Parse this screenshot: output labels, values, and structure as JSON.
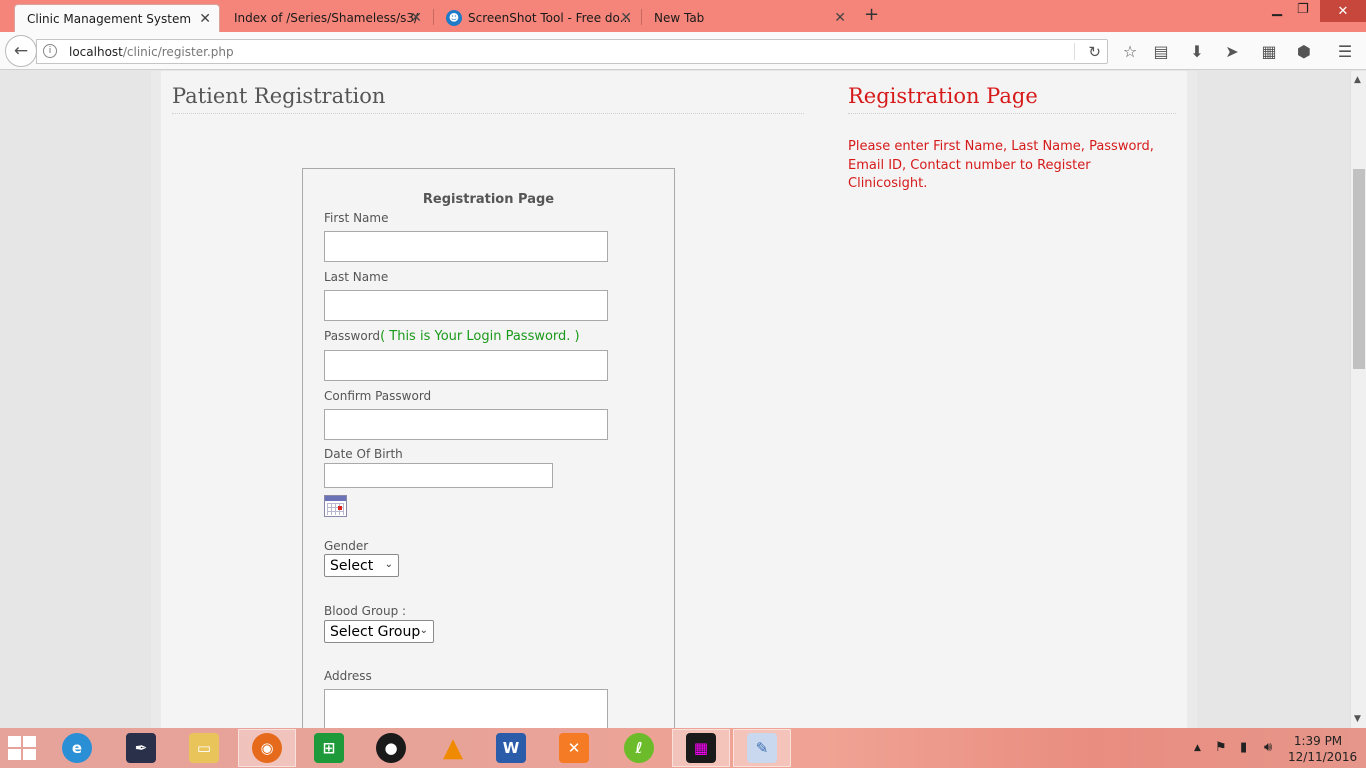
{
  "browser": {
    "tabs": [
      {
        "label": "Clinic Management System",
        "active": true
      },
      {
        "label": "Index of /Series/Shameless/s3/",
        "active": false
      },
      {
        "label": "ScreenShot Tool - Free do...",
        "active": false
      },
      {
        "label": "New Tab",
        "active": false
      }
    ],
    "url_host": "localhost",
    "url_path": "/clinic/register.php"
  },
  "page": {
    "heading": "Patient Registration",
    "side_heading": "Registration Page",
    "side_text": "Please enter First Name, Last Name, Password, Email ID, Contact number to Register Clinicosight."
  },
  "form": {
    "title": "Registration Page",
    "first_name_label": "First Name",
    "last_name_label": "Last Name",
    "password_label": "Password",
    "password_hint": "( This is Your Login Password. )",
    "confirm_password_label": "Confirm Password",
    "dob_label": "Date Of Birth",
    "gender_label": "Gender",
    "gender_selected": "Select",
    "blood_group_label": "Blood Group :",
    "blood_group_selected": "Select Group",
    "address_label": "Address"
  },
  "taskbar": {
    "clock_time": "1:39 PM",
    "clock_date": "12/11/2016"
  }
}
